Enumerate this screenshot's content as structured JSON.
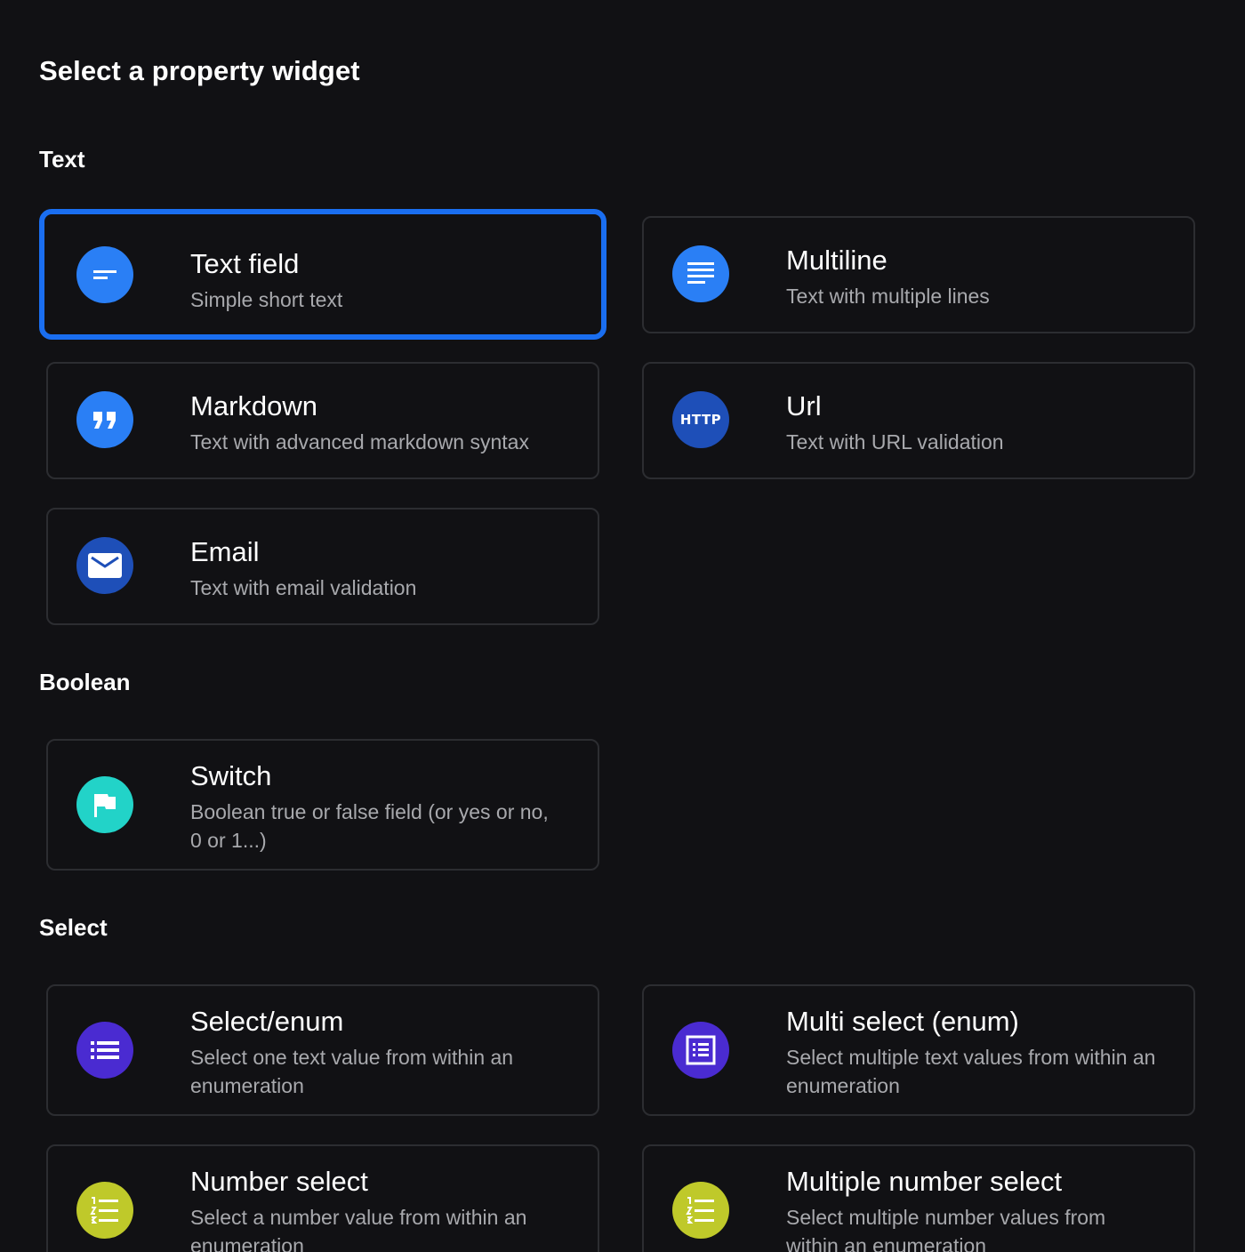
{
  "page": {
    "title": "Select a property widget"
  },
  "sections": {
    "text": {
      "label": "Text"
    },
    "boolean": {
      "label": "Boolean"
    },
    "select": {
      "label": "Select"
    }
  },
  "widgets": {
    "text_field": {
      "title": "Text field",
      "description": "Simple short text",
      "icon": "short-text-icon",
      "color": "#2a7ff5"
    },
    "multiline": {
      "title": "Multiline",
      "description": "Text with multiple lines",
      "icon": "multiline-text-icon",
      "color": "#2a7ff5"
    },
    "markdown": {
      "title": "Markdown",
      "description": "Text with advanced markdown syntax",
      "icon": "quote-icon",
      "color": "#2a7ff5"
    },
    "url": {
      "title": "Url",
      "description": "Text with URL validation",
      "icon": "http-icon",
      "icon_text": "HTTP",
      "color": "#1e4fb8"
    },
    "email": {
      "title": "Email",
      "description": "Text with email validation",
      "icon": "mail-icon",
      "color": "#1e4fb8"
    },
    "switch": {
      "title": "Switch",
      "description": "Boolean true or false field (or yes or no, 0 or 1...)",
      "icon": "flag-icon",
      "color": "#22d3c8"
    },
    "select_enum": {
      "title": "Select/enum",
      "description": "Select one text value from within an enumeration",
      "icon": "list-icon",
      "color": "#4a2bd1"
    },
    "multi_select_enum": {
      "title": "Multi select (enum)",
      "description": "Select multiple text values from within an enumeration",
      "icon": "list-alt-icon",
      "color": "#4a2bd1"
    },
    "number_select": {
      "title": "Number select",
      "description": "Select a number value from within an enumeration",
      "icon": "numbered-list-icon",
      "color": "#bfc92a"
    },
    "multiple_number_select": {
      "title": "Multiple number select",
      "description": "Select multiple number values from within an enumeration",
      "icon": "numbered-list-icon",
      "color": "#bfc92a"
    }
  },
  "selected_widget": "text_field"
}
